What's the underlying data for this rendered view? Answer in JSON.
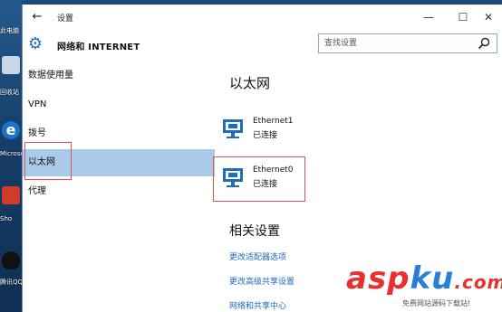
{
  "desktop": {
    "icons": [
      {
        "name": "this-pc",
        "label": "此电脑"
      },
      {
        "name": "recycle-bin",
        "label": "回收站"
      },
      {
        "name": "microsoft-edge",
        "label": "Microsoft Edge"
      },
      {
        "name": "shortcut",
        "label": "Sho"
      },
      {
        "name": "tencent-qq",
        "label": "腾讯QQ"
      }
    ]
  },
  "window": {
    "title": "设置",
    "back": "←",
    "minimize": "—",
    "maximize": "☐",
    "close": "✕"
  },
  "header": {
    "section_title": "网络和 INTERNET",
    "search_placeholder": "查找设置"
  },
  "nav": {
    "items": [
      {
        "label": "数据使用量",
        "selected": false
      },
      {
        "label": "VPN",
        "selected": false
      },
      {
        "label": "拨号",
        "selected": false
      },
      {
        "label": "以太网",
        "selected": true
      },
      {
        "label": "代理",
        "selected": false
      }
    ]
  },
  "content": {
    "title": "以太网",
    "networks": [
      {
        "name": "Ethernet1",
        "status": "已连接"
      },
      {
        "name": "Ethernet0",
        "status": "已连接"
      }
    ],
    "related_title": "相关设置",
    "links": [
      "更改适配器选项",
      "更改高级共享设置",
      "网络和共享中心"
    ]
  },
  "watermark": {
    "brand": "aspku.com",
    "tagline": "免费网站源码下载站!"
  },
  "colors": {
    "accent": "#1f6fb8",
    "nav_selected": "#a9cbe9",
    "link": "#1e68c2",
    "highlight_border": "#e05050",
    "watermark_red": "#e8312f",
    "watermark_blue": "#2a7fd4"
  }
}
